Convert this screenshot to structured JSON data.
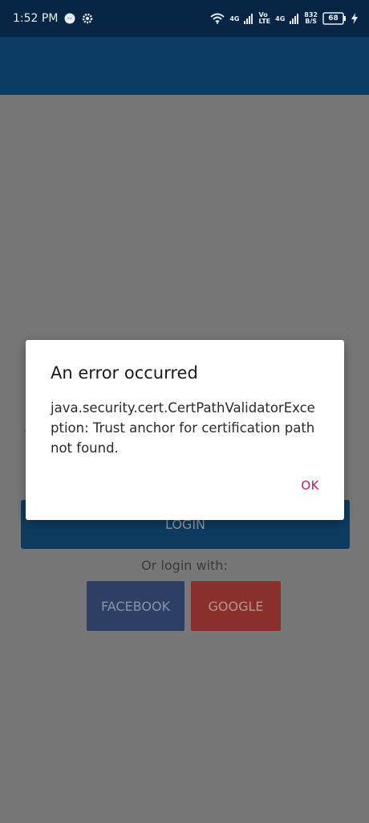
{
  "status_bar": {
    "time": "1:52 PM",
    "network_speed": "832\nB/S",
    "network_speed_top": "832",
    "network_speed_bottom": "B/S",
    "sim1_type": "4G",
    "volte_top": "Vo",
    "volte_bottom": "LTE",
    "sim2_type": "4G",
    "battery": "68"
  },
  "main": {
    "login_label": "LOGIN",
    "or_login_with": "Or login with:",
    "facebook_label": "FACEBOOK",
    "google_label": "GOOGLE"
  },
  "dialog": {
    "title": "An error occurred",
    "message": "java.security.cert.CertPathValidatorException: Trust anchor for certification path not found.",
    "ok_label": "OK"
  },
  "colors": {
    "status_bar": "#062444",
    "app_bar": "#0b3c64",
    "accent": "#c2185b",
    "facebook": "#2e3f66",
    "google": "#8a302c"
  }
}
